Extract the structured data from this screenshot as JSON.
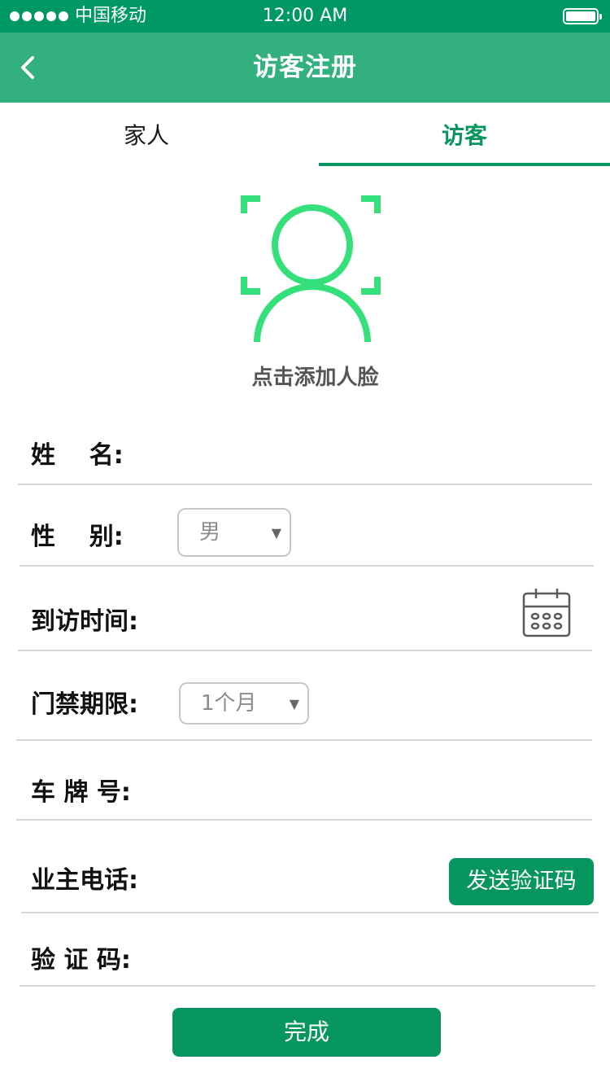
{
  "status_bar": {
    "carrier": "中国移动",
    "time": "12:00 AM",
    "signal_icon": "signal-dots-icon",
    "battery_icon": "battery-icon"
  },
  "nav": {
    "title": "访客注册",
    "back_icon": "chevron-left-icon"
  },
  "tabs": [
    {
      "label": "家人",
      "active": false
    },
    {
      "label": "访客",
      "active": true
    }
  ],
  "face": {
    "icon": "face-scan-icon",
    "label": "点击添加人脸"
  },
  "form": {
    "name": {
      "label": "姓    名:",
      "value": ""
    },
    "gender": {
      "label": "性    别:",
      "selected": "男"
    },
    "visit_time": {
      "label": "到访时间:",
      "value": "",
      "icon": "calendar-icon"
    },
    "access_period": {
      "label": "门禁期限:",
      "selected": "1个月"
    },
    "plate": {
      "label": "车 牌 号:",
      "value": ""
    },
    "owner_phone": {
      "label": "业主电话:",
      "value": "",
      "button": "发送验证码"
    },
    "code": {
      "label": "验 证 码:",
      "value": ""
    }
  },
  "submit_label": "完成",
  "colors": {
    "status_bar": "#009966",
    "nav_bar": "#33b080",
    "accent": "#07965f",
    "face_icon": "#34e07a"
  }
}
